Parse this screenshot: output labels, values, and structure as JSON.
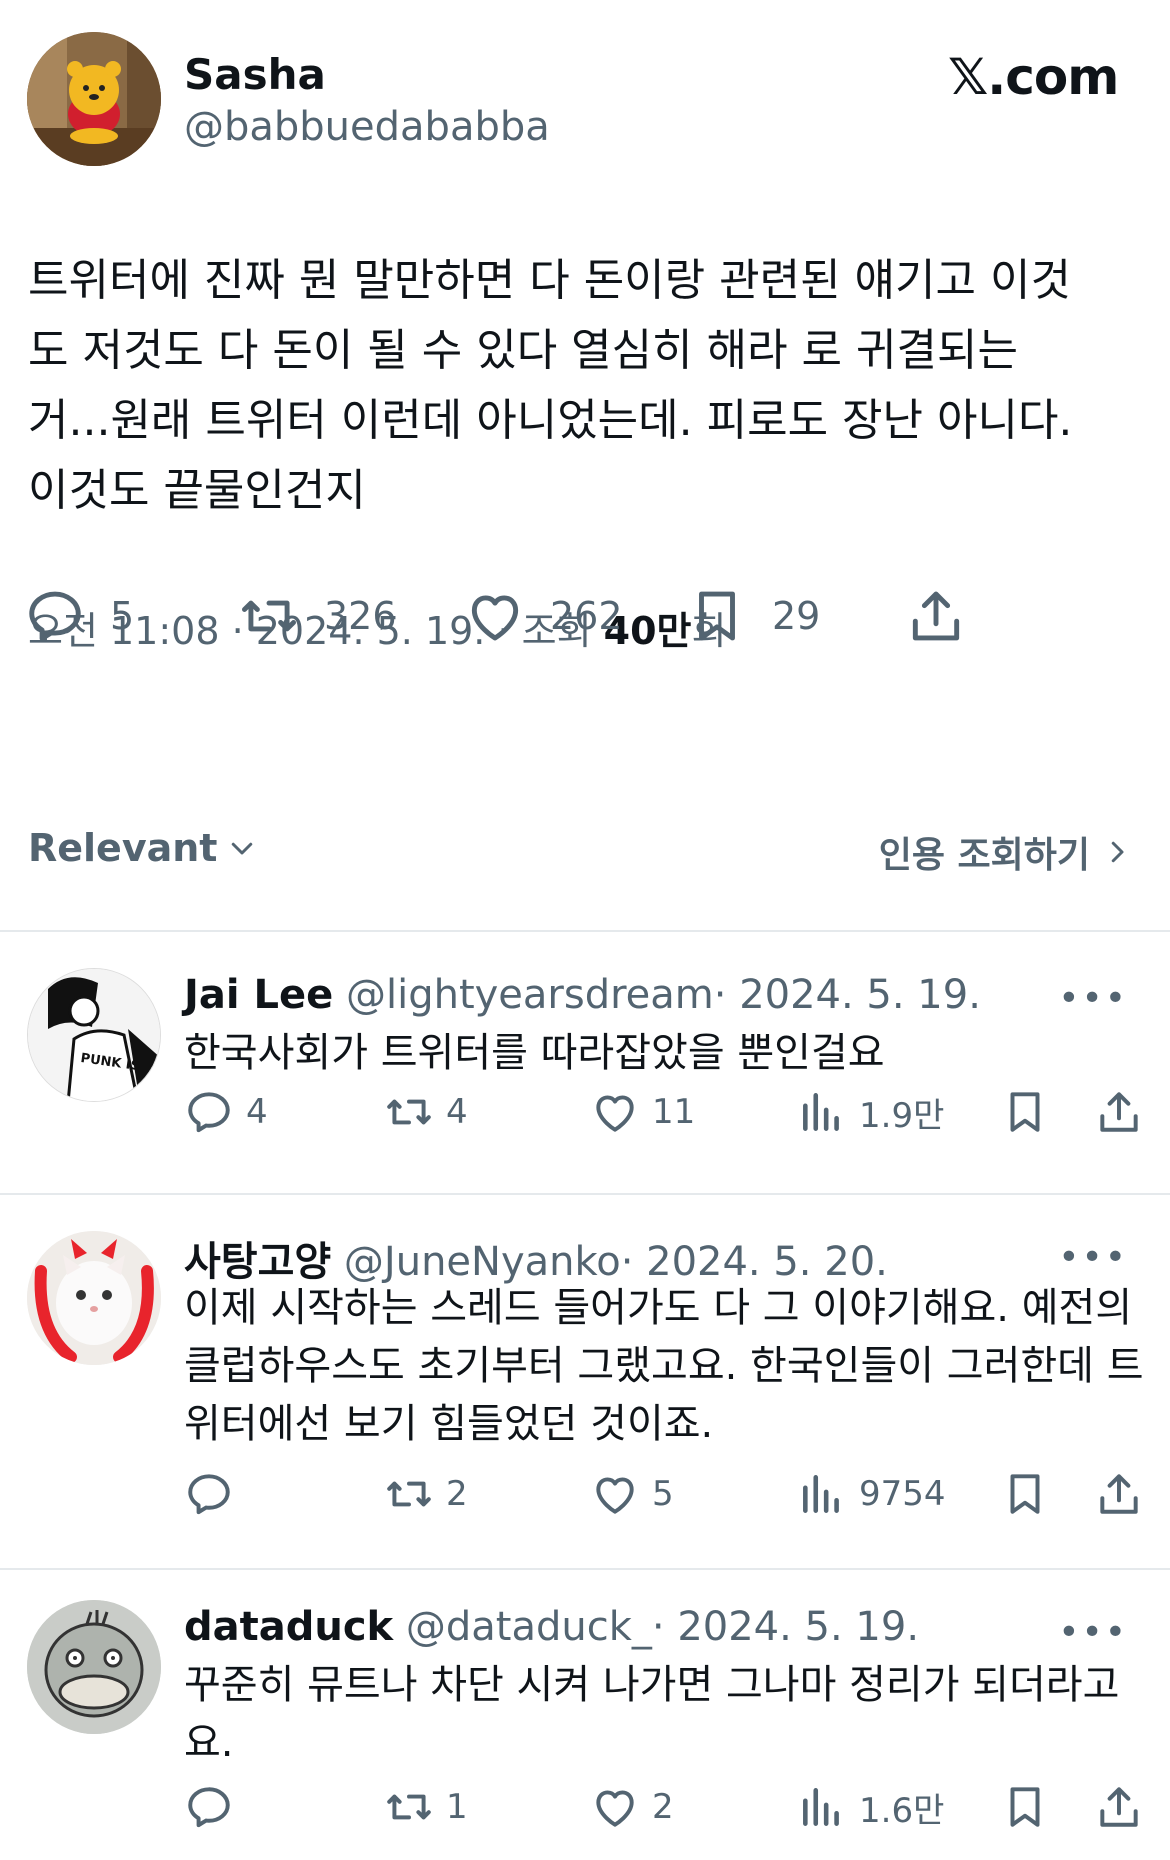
{
  "tweet": {
    "name": "Sasha",
    "handle": "@babbuedababba",
    "brand": "𝕏.com",
    "text": "트위터에 진짜 뭔 말만하면 다 돈이랑 관련된 얘기고 이것\n도 저것도 다 돈이 될 수 있다 열심히 해라 로 귀결되는\n거...원래 트위터 이런데 아니었는데. 피로도 장난 아니다.\n이것도 끝물인건지",
    "meta_prefix": "오전 11:08 · 2024. 5. 19. · 조회 ",
    "views": "40만",
    "meta_suffix": "회",
    "stats": {
      "replies": "5",
      "retweets": "326",
      "likes": "262",
      "bookmarks": "29"
    }
  },
  "filter": {
    "sort_label": "Relevant",
    "quotes_label": "인용 조회하기"
  },
  "replies": [
    {
      "name": "Jai Lee",
      "handle": "@lightyearsdream",
      "date": "· 2024. 5. 19.",
      "text": "한국사회가 트위터를 따라잡았을 뿐인걸요",
      "replies": "4",
      "retweets": "4",
      "likes": "11",
      "views": "1.9만",
      "avatar_text": "PUNK IS NOT DED"
    },
    {
      "name": "사탕고양",
      "handle": "@JuneNyanko",
      "date": "· 2024. 5. 20.",
      "text": "이제 시작하는 스레드 들어가도 다 그 이야기해요. 예전의 클럽하우스도 초기부터 그랬고요. 한국인들이 그러한데 트위터에선 보기 힘들었던 것이죠.",
      "replies": "",
      "retweets": "2",
      "likes": "5",
      "views": "9754"
    },
    {
      "name": "dataduck",
      "handle": "@dataduck_",
      "date": "· 2024. 5. 19.",
      "text": "꾸준히 뮤트나 차단 시켜 나가면 그나마 정리가 되더라고요.",
      "replies": "",
      "retweets": "1",
      "likes": "2",
      "views": "1.6만"
    }
  ],
  "icons": [
    "reply-icon",
    "retweet-icon",
    "like-icon",
    "bookmark-icon",
    "share-icon",
    "views-icon",
    "more-icon",
    "chevron-down-icon",
    "chevron-right-icon"
  ],
  "colors": {
    "text": "#0f1419",
    "secondary": "#536471",
    "divider": "#e5e9ec",
    "background": "#ffffff"
  }
}
